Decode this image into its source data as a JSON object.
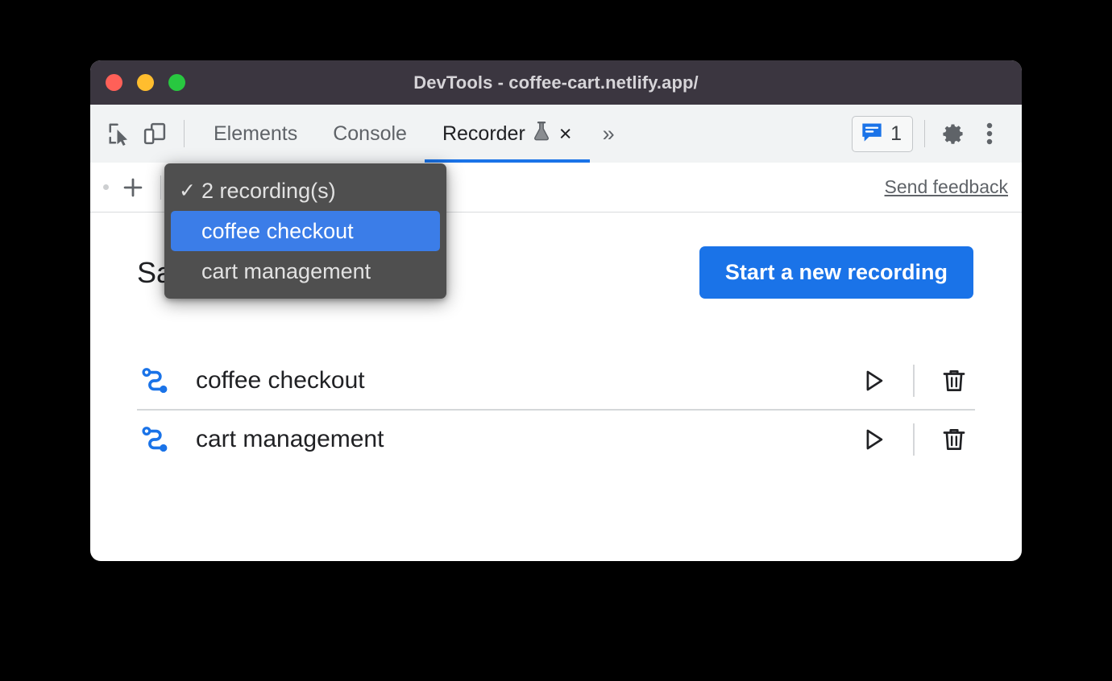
{
  "window": {
    "title": "DevTools - coffee-cart.netlify.app/",
    "traffic_lights": [
      {
        "name": "close",
        "color": "#ff6058"
      },
      {
        "name": "minimize",
        "color": "#ffbd2e"
      },
      {
        "name": "zoom",
        "color": "#28c840"
      }
    ]
  },
  "tabbar": {
    "inspect_icon": "inspect-element-icon",
    "device_icon": "device-toolbar-icon",
    "tabs": [
      {
        "label": "Elements",
        "active": false
      },
      {
        "label": "Console",
        "active": false
      },
      {
        "label": "Recorder",
        "active": true,
        "experimental": true,
        "closable": true
      }
    ],
    "more_tabs_label": "»",
    "close_label": "×",
    "issues": {
      "icon": "issues-message-icon",
      "count": "1"
    },
    "settings_icon": "gear-icon",
    "menu_icon": "kebab-menu-icon"
  },
  "recorder_toolbar": {
    "add_label": "+",
    "add_icon": "plus-icon",
    "selector_value": "2 recording(s)",
    "export_icon": "export-upload-icon",
    "import_icon": "import-download-icon",
    "delete_icon": "trash-icon",
    "feedback_label": "Send feedback"
  },
  "dropdown": {
    "open": true,
    "items": [
      {
        "label": "2 recording(s)",
        "checked": true,
        "selected": false
      },
      {
        "label": "coffee checkout",
        "checked": false,
        "selected": true
      },
      {
        "label": "cart management",
        "checked": false,
        "selected": false
      }
    ],
    "check_glyph": "✓",
    "background_color": "#4f4f4f",
    "highlight_color": "#3b7de8"
  },
  "main": {
    "title": "Saved recordings",
    "start_button_label": "Start a new recording",
    "accent_color": "#1a73e8",
    "recordings": [
      {
        "name": "coffee checkout",
        "icon": "recording-path-icon",
        "play_icon": "play-icon",
        "delete_icon": "trash-icon"
      },
      {
        "name": "cart management",
        "icon": "recording-path-icon",
        "play_icon": "play-icon",
        "delete_icon": "trash-icon"
      }
    ]
  }
}
